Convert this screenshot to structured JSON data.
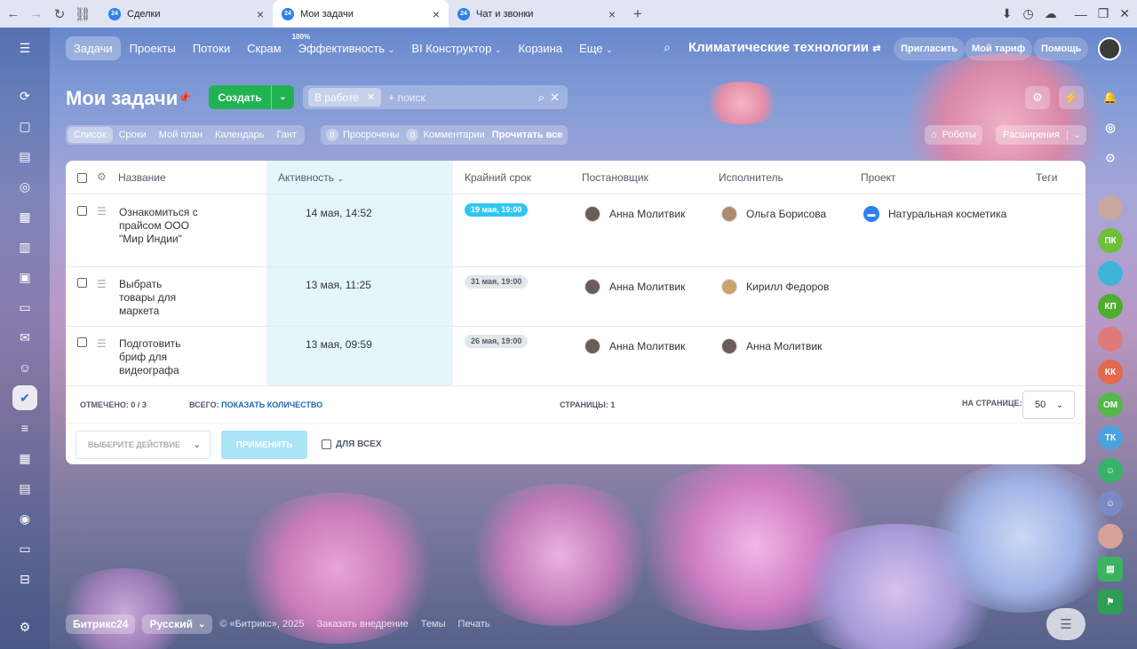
{
  "browser": {
    "tabs": [
      {
        "label": "Сделки",
        "favicon": "24"
      },
      {
        "label": "Мои задачи",
        "favicon": "24"
      },
      {
        "label": "Чат и звонки",
        "favicon": "24"
      }
    ],
    "new_tab": "+"
  },
  "topnav": {
    "items": [
      "Задачи",
      "Проекты",
      "Потоки",
      "Скрам",
      "Эффективность",
      "BI Конструктор",
      "Корзина",
      "Еще"
    ],
    "efficiency_badge": "100%",
    "company": "Климатические технологии",
    "invite": "Пригласить",
    "tariff": "Мой тариф",
    "help": "Помощь"
  },
  "page": {
    "title": "Мои задачи",
    "create": "Создать",
    "filter_chip": "В работе",
    "search_placeholder": "+ поиск"
  },
  "views": [
    "Список",
    "Сроки",
    "Мой план",
    "Календарь",
    "Гант"
  ],
  "counters": {
    "overdue_count": "0",
    "overdue": "Просрочены",
    "comments_count": "0",
    "comments": "Комментарии",
    "read_all": "Прочитать все"
  },
  "robots": "Роботы",
  "extensions": "Расширения",
  "grid": {
    "columns": {
      "name": "Название",
      "activity": "Активность",
      "deadline": "Крайний срок",
      "creator": "Постановщик",
      "responsible": "Исполнитель",
      "project": "Проект",
      "tags": "Теги"
    },
    "rows": [
      {
        "name": "Ознакомиться с прайсом ООО \"Мир Индии\"",
        "activity": "14 мая, 14:52",
        "deadline": "19 мая, 19:00",
        "creator": "Анна Молитвик",
        "responsible": "Ольга Борисова",
        "project": "Натуральная косметика"
      },
      {
        "name": "Выбрать товары для маркета",
        "activity": "13 мая, 11:25",
        "deadline": "31 мая, 19:00",
        "creator": "Анна Молитвик",
        "responsible": "Кирилл Федоров",
        "project": ""
      },
      {
        "name": "Подготовить бриф для видеографа",
        "activity": "13 мая, 09:59",
        "deadline": "26 мая, 19:00",
        "creator": "Анна Молитвик",
        "responsible": "Анна Молитвик",
        "project": ""
      }
    ],
    "footer": {
      "checked_label": "ОТМЕЧЕНО:",
      "checked_value": "0 / 3",
      "total_label": "ВСЕГО:",
      "total_link": "ПОКАЗАТЬ КОЛИЧЕСТВО",
      "pages_label": "СТРАНИЦЫ:",
      "pages_value": "1",
      "per_page_label": "НА СТРАНИЦЕ:",
      "per_page_value": "50"
    },
    "actions": {
      "select_action": "ВЫБЕРИТЕ ДЕЙСТВИЕ",
      "apply": "ПРИМЕНИТЬ",
      "for_all": "ДЛЯ ВСЕХ"
    }
  },
  "right_sidebar": [
    "ПК",
    "КП",
    "КК",
    "ОМ",
    "ТК"
  ],
  "page_footer": {
    "brand": "Битрикс24",
    "language": "Русский",
    "copyright": "© «Битрикс», 2025",
    "order": "Заказать внедрение",
    "themes": "Темы",
    "print": "Печать"
  },
  "colors": {
    "accent": "#2fc6f6",
    "create_green": "#21b352",
    "activity_bg": "#e5f6fb"
  }
}
